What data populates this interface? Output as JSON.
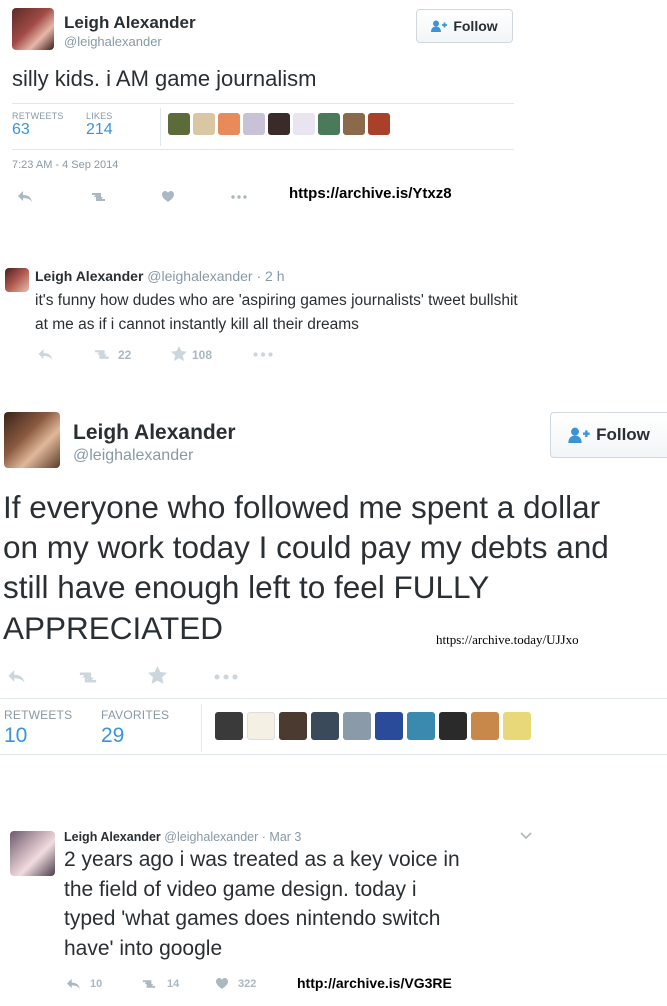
{
  "tweet1": {
    "name": "Leigh Alexander",
    "handle": "@leighalexander",
    "follow_label": "Follow",
    "text": "silly kids. i AM game journalism",
    "retweets_label": "RETWEETS",
    "retweets": "63",
    "likes_label": "LIKES",
    "likes": "214",
    "timestamp": "7:23 AM - 4 Sep 2014",
    "archive_link": "https://archive.is/Ytxz8"
  },
  "tweet2": {
    "name": "Leigh Alexander",
    "handle": "@leighalexander",
    "time": "· 2 h",
    "text_line1": "it's funny how dudes who are 'aspiring games journalists' tweet bullshit",
    "text_line2": "at me as if i cannot instantly kill all their dreams",
    "retweets": "22",
    "favorites": "108"
  },
  "tweet3": {
    "name": "Leigh Alexander",
    "handle": "@leighalexander",
    "follow_label": "Follow",
    "text_line1": "If everyone who followed me spent a dollar",
    "text_line2": "on my work today I could pay my debts and",
    "text_line3": "still have enough left to feel FULLY",
    "text_line4": "APPRECIATED",
    "archive_link": "https://archive.today/UJJxo",
    "retweets_label": "RETWEETS",
    "retweets": "10",
    "favorites_label": "FAVORITES",
    "favorites": "29"
  },
  "tweet4": {
    "name": "Leigh Alexander",
    "handle": "@leighalexander",
    "date": "· Mar 3",
    "text_line1": "2 years ago i was treated as a key voice in",
    "text_line2": "the field of video game design. today i",
    "text_line3": "typed 'what games does nintendo switch",
    "text_line4": "have' into google",
    "replies": "10",
    "retweets": "14",
    "likes": "322",
    "archive_link": "http://archive.is/VG3RE"
  },
  "colors": {
    "accent_blue": "#3b94d9",
    "muted_gray": "#8899a6",
    "icon_gray": "#aab8c2",
    "text_dark": "#292f33"
  },
  "icons": [
    "reply-icon",
    "retweet-icon",
    "like-icon",
    "star-icon",
    "more-icon",
    "add-user-icon",
    "chevron-down-icon"
  ]
}
